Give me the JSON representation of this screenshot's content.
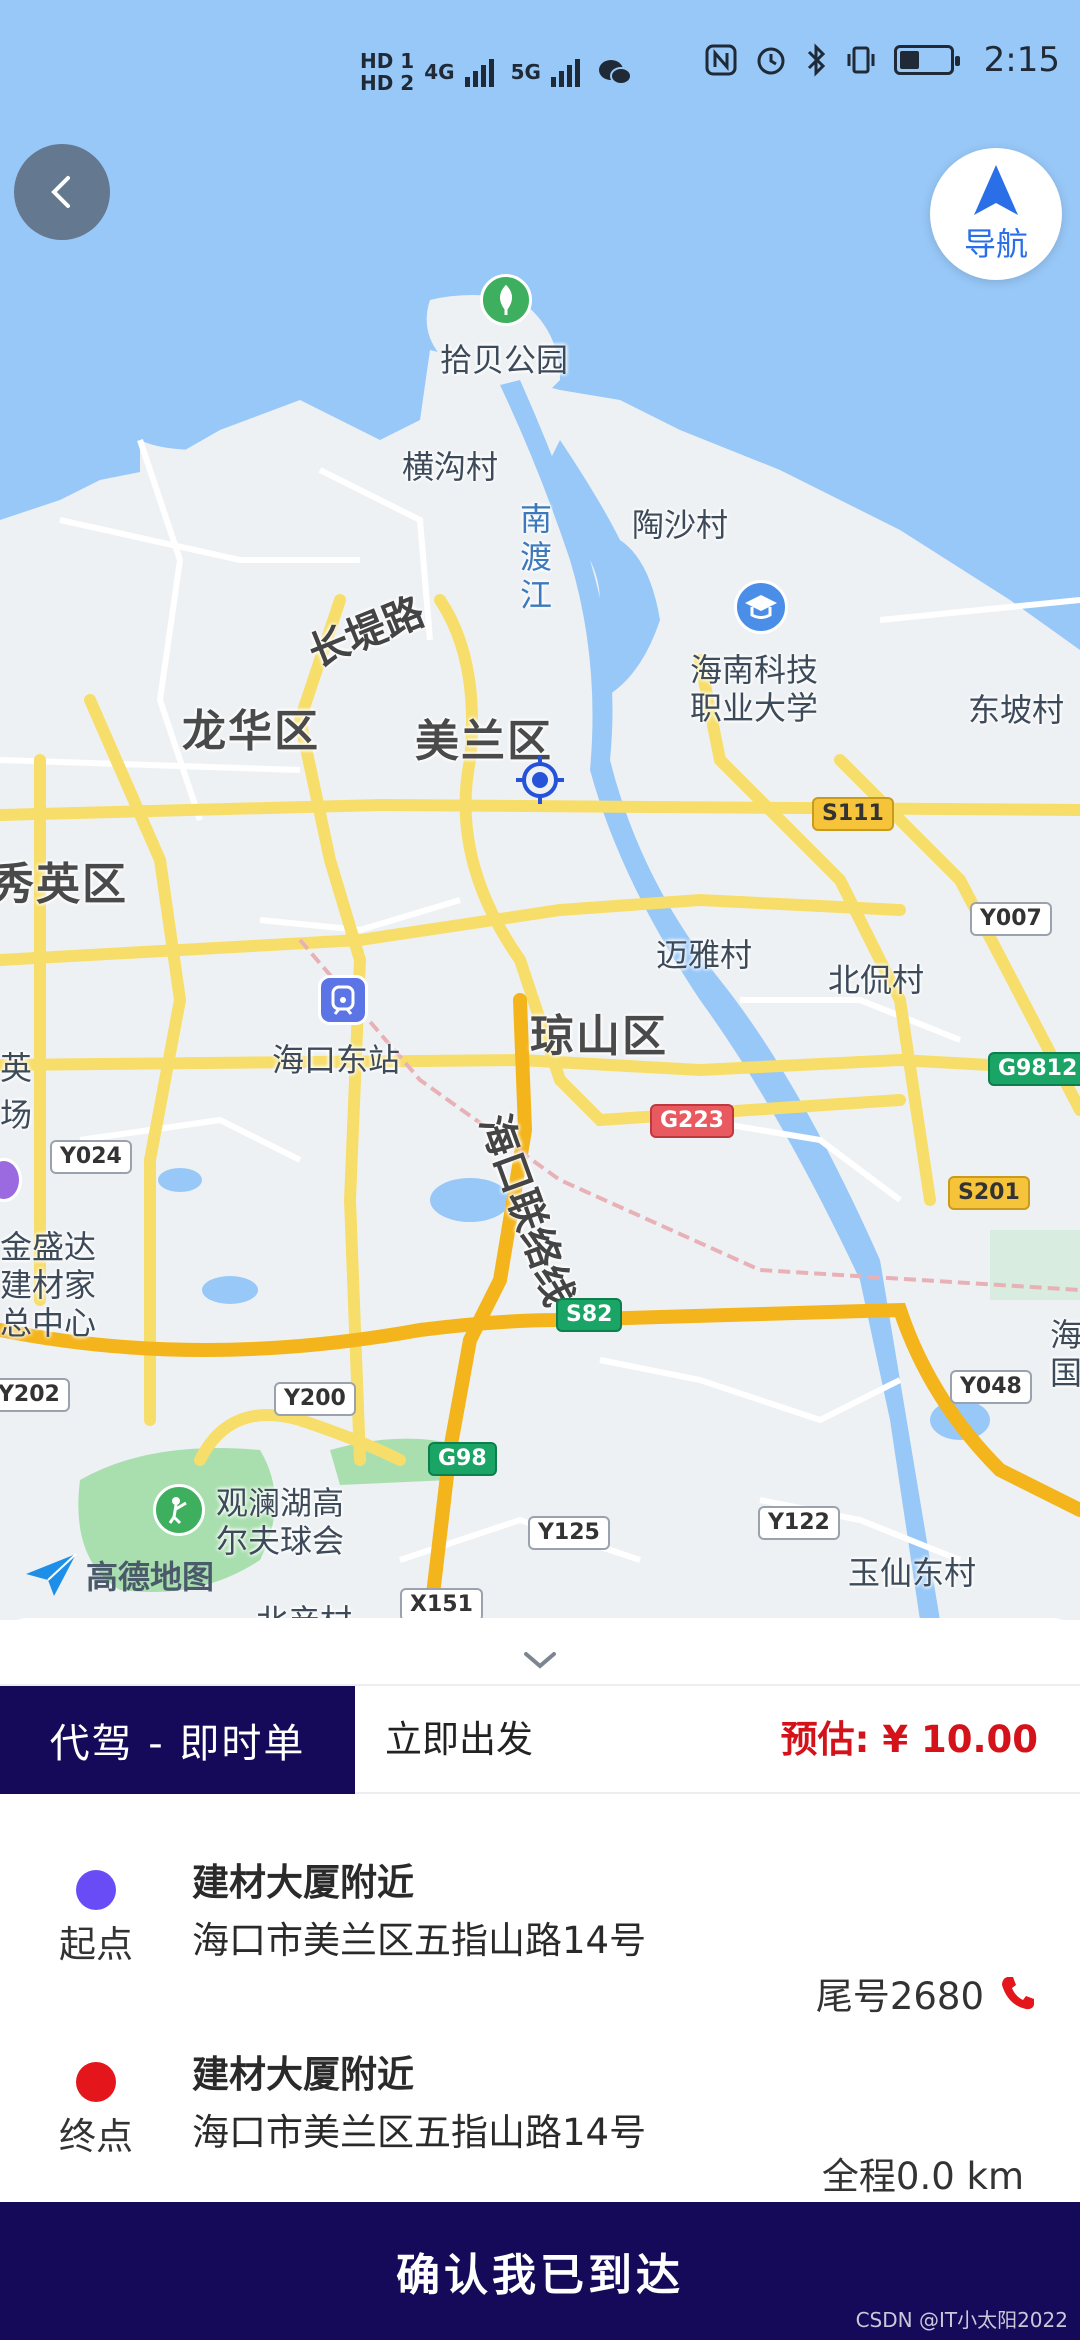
{
  "status_bar": {
    "signal_left": [
      "HD 1",
      "HD 2",
      "4G",
      "5G"
    ],
    "time": "2:15",
    "battery_level": 0.35
  },
  "map": {
    "nav_label": "导航",
    "logo_text": "高德地图",
    "places": {
      "shibei_park": "拾贝公园",
      "henggou": "横沟村",
      "nandu_river": "南渡江",
      "taosha": "陶沙村",
      "changdi_road": "长堤路",
      "hainan_sci": "海南科技",
      "hainan_sci2": "职业大学",
      "longhua": "龙华区",
      "meilan": "美兰区",
      "dongpo": "东坡村",
      "xiuying": "秀英区",
      "maiya": "迈雅村",
      "beikan": "北侃村",
      "qiongshan": "琼山区",
      "haikou_east": "海口东站",
      "lianluo": "海口联络线",
      "jinshengda1": "金盛达",
      "jinshengda2": "建材家",
      "jinshengda3": "总中心",
      "guanlan1": "观澜湖高",
      "guanlan2": "尔夫球会",
      "yuxian": "玉仙东村",
      "beichan": "北产村",
      "hai": "海",
      "guo": "国",
      "ying": "英",
      "chang": "场"
    },
    "shields": {
      "s111": "S111",
      "y007": "Y007",
      "g9812": "G9812",
      "g223": "G223",
      "s201": "S201",
      "y024": "Y024",
      "s82": "S82",
      "y048": "Y048",
      "y202": "Y202",
      "y200": "Y200",
      "g98": "G98",
      "y125": "Y125",
      "y122": "Y122",
      "x151": "X151"
    }
  },
  "order": {
    "type_label": "代驾 - 即时单",
    "depart_label": "立即出发",
    "estimate_label": "预估: ¥ 10.00"
  },
  "start": {
    "label": "起点",
    "title": "建材大厦附近",
    "address": "海口市美兰区五指山路14号",
    "color": "#6a4cf6"
  },
  "end": {
    "label": "终点",
    "title": "建材大厦附近",
    "address": "海口市美兰区五指山路14号",
    "color": "#e4161c"
  },
  "tail_number": "尾号2680",
  "distance": "全程0.0 km",
  "confirm_label": "确认我已到达",
  "watermark": "CSDN @IT小太阳2022"
}
